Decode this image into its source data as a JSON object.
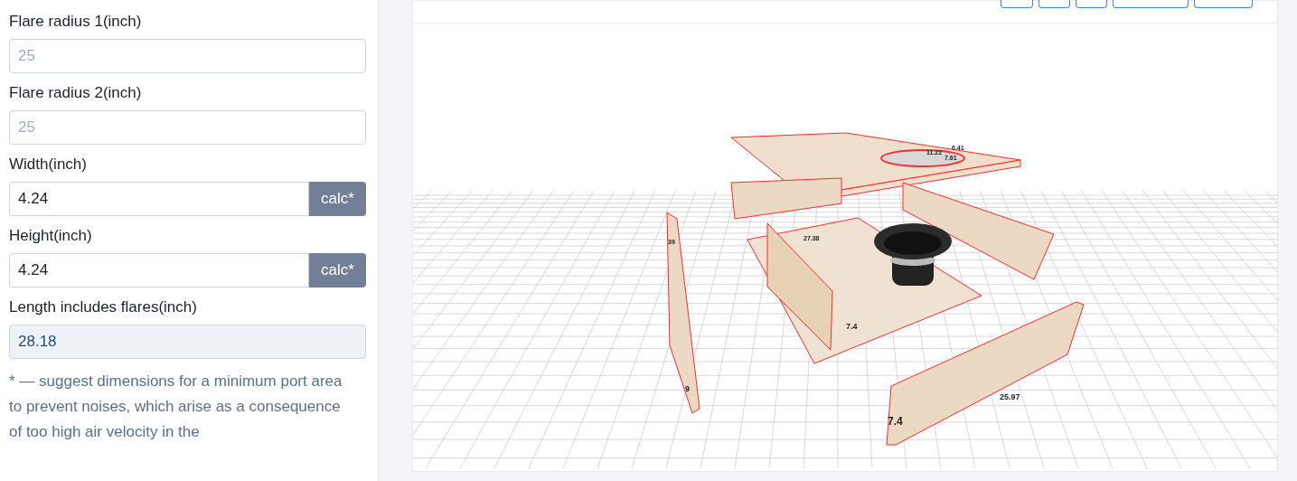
{
  "form": {
    "fields": [
      {
        "kind": "input",
        "label": "Flare radius 1(inch)",
        "placeholder": "25"
      },
      {
        "kind": "input",
        "label": "Flare radius 2(inch)",
        "placeholder": "25"
      },
      {
        "kind": "calc",
        "label": "Width(inch)",
        "value": "4.24",
        "button": "calc*"
      },
      {
        "kind": "calc",
        "label": "Height(inch)",
        "value": "4.24",
        "button": "calc*"
      },
      {
        "kind": "readonly",
        "label": "Length includes flares(inch)",
        "value": "28.18"
      }
    ],
    "note": "* — suggest dimensions for a minimum port area to prevent noises, which arise as a consequence of too high air velocity in the"
  },
  "viewer": {
    "dimension_labels": [
      {
        "text": "6.41"
      },
      {
        "text": "11.22"
      },
      {
        "text": "7.61"
      },
      {
        "text": "39"
      },
      {
        "text": "27.38"
      },
      {
        "text": "7.4"
      },
      {
        "text": "9"
      },
      {
        "text": "25.97"
      },
      {
        "text": "7.4"
      }
    ]
  }
}
